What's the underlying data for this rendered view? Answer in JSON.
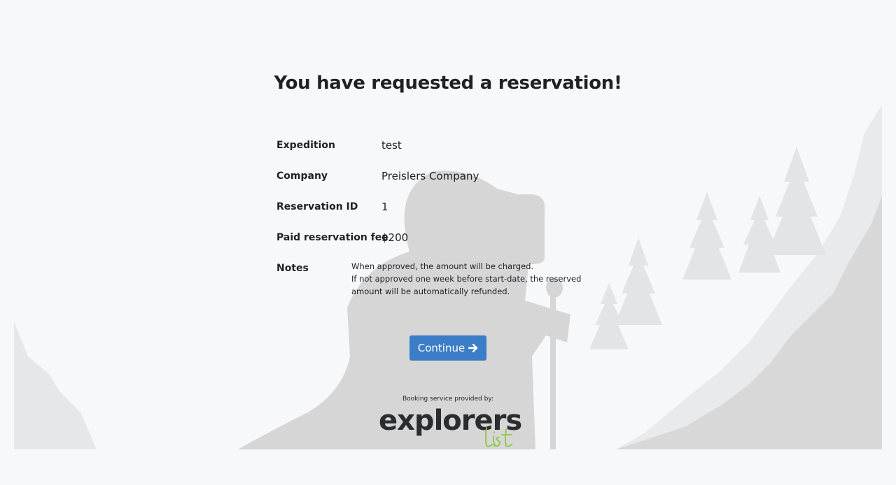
{
  "page": {
    "title": "You have requested a reservation!"
  },
  "details": {
    "expedition_label": "Expedition",
    "expedition_value": "test",
    "company_label": "Company",
    "company_value": "Preislers Company",
    "reservation_id_label": "Reservation ID",
    "reservation_id_value": "1",
    "fee_label": "Paid reservation fee",
    "fee_value": "$200",
    "notes_label": "Notes",
    "notes_line1": "When approved, the amount will be charged.",
    "notes_line2": "If not approved one week before start-date, the reserved amount will be automatically refunded."
  },
  "actions": {
    "continue_label": "Continue",
    "continue_icon": "arrow-right-icon"
  },
  "footer": {
    "provided_by": "Booking service provided by:",
    "brand_main": "explorers",
    "brand_sub": "list"
  },
  "colors": {
    "accent": "#3b7dc6",
    "brand_green": "#8cc63f",
    "background": "#f7f8fa",
    "illustration_light": "#e8e9ea",
    "illustration_dark": "#d6d6d7"
  }
}
